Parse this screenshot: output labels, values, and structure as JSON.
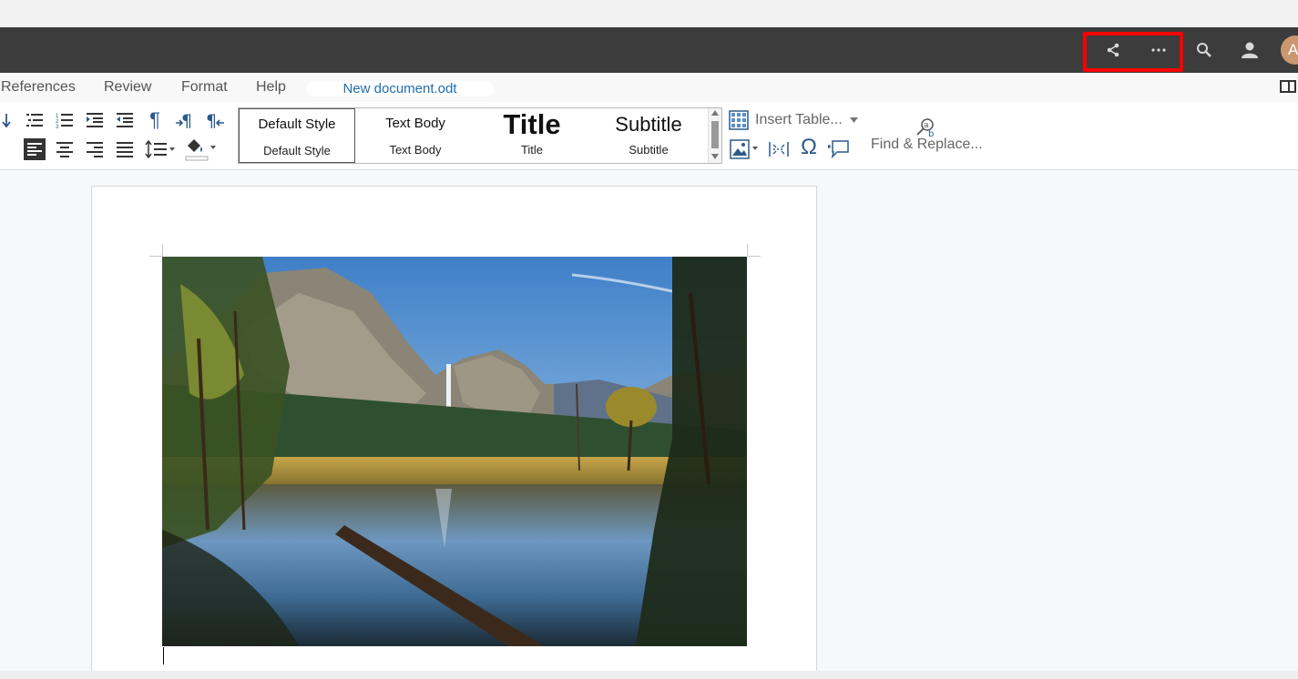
{
  "menubar": {
    "items": [
      "References",
      "Review",
      "Format",
      "Help"
    ],
    "document_title": "New document.odt"
  },
  "header": {
    "icons": [
      "share-icon",
      "more-options-icon",
      "search-icon",
      "user-icon"
    ],
    "avatar_initial": "A",
    "highlight_color": "#ff0000"
  },
  "styles": [
    {
      "preview": "Default Style",
      "label": "Default Style"
    },
    {
      "preview": "Text Body",
      "label": "Text Body"
    },
    {
      "preview": "Title",
      "label": "Title"
    },
    {
      "preview": "Subtitle",
      "label": "Subtitle"
    }
  ],
  "toolbar": {
    "insert_table_label": "Insert Table...",
    "find_replace_label": "Find & Replace...",
    "special_char_glyph": "Ω",
    "paragraph_glyph": "¶"
  },
  "colors": {
    "header_bg": "#3c3c3c",
    "title_link": "#1e6fb0",
    "icon_blue": "#2a5a8a"
  }
}
